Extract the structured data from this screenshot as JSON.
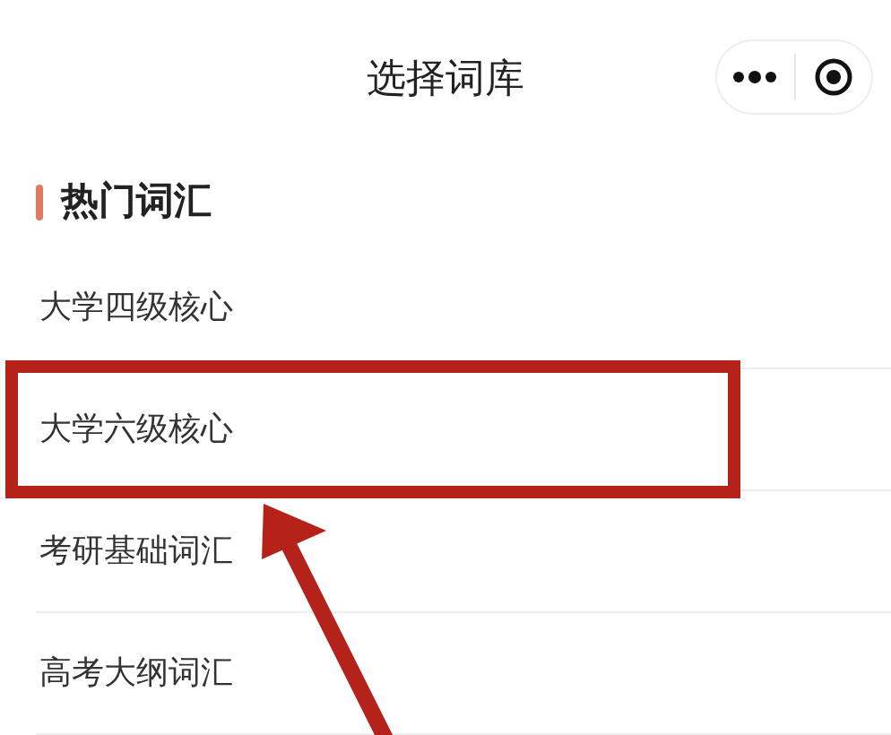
{
  "nav_bar": {
    "title": "选择词库"
  },
  "section": {
    "heading": "热门词汇",
    "items": [
      {
        "label": "大学四级核心",
        "highlighted": false
      },
      {
        "label": "大学六级核心",
        "highlighted": true
      },
      {
        "label": "考研基础词汇",
        "highlighted": false
      },
      {
        "label": "高考大纲词汇",
        "highlighted": false
      }
    ]
  }
}
